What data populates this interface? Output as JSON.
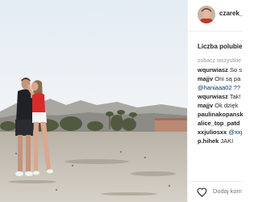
{
  "post": {
    "username": "czarek_",
    "likes_label": "Liczba polubień",
    "show_all_label": "zobacz wszystkie",
    "comments": [
      {
        "user": "wqurwiasz",
        "text": "So s"
      },
      {
        "user": "majjv",
        "text": "Oni są pa"
      },
      {
        "mention": "@haniaaa02",
        "text": "??"
      },
      {
        "user": "wqurwiasz",
        "text": "Tak!"
      },
      {
        "user": "majjv",
        "text": "Ok dzięk"
      },
      {
        "user": "paulinakopansk",
        "text": ""
      },
      {
        "user": "alice_top_patd",
        "text": ""
      },
      {
        "user": "xxjuliosxx",
        "mention": "@xxj"
      },
      {
        "user": "p.hihek",
        "text": "JAKI"
      }
    ],
    "add_comment_placeholder": "Dodaj kom"
  },
  "colors": {
    "link": "#003569",
    "muted": "#999999",
    "text": "#262626",
    "border": "#efefef"
  },
  "icons": {
    "like": "heart-icon"
  }
}
